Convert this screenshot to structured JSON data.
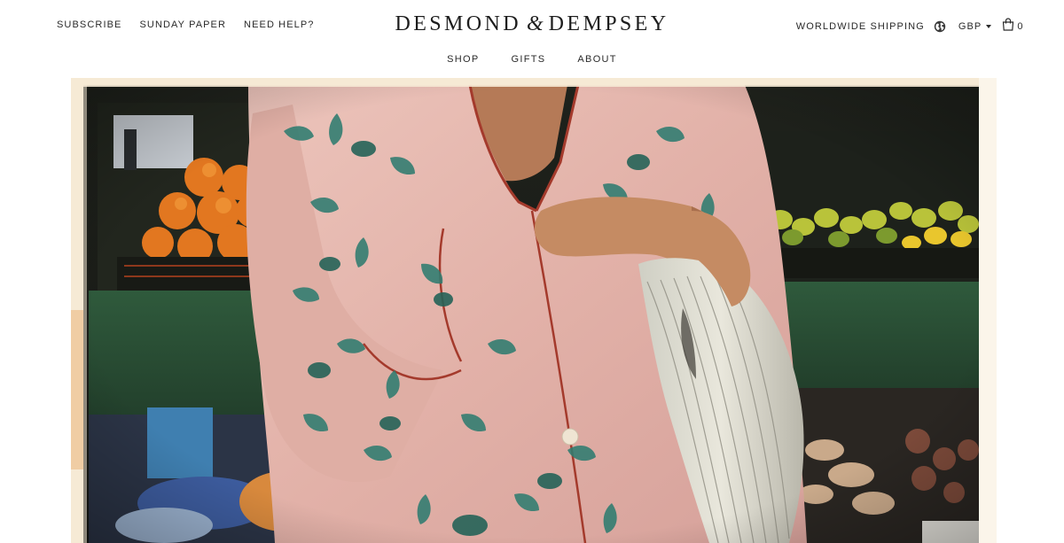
{
  "header": {
    "left_links": [
      {
        "label": "SUBSCRIBE"
      },
      {
        "label": "SUNDAY PAPER"
      },
      {
        "label": "NEED HELP?"
      }
    ],
    "brand": {
      "part1": "DESMOND",
      "amp": "&",
      "part2": "DEMPSEY"
    },
    "right": {
      "shipping_label": "WORLDWIDE SHIPPING",
      "globe_icon": "globe-icon",
      "currency": "GBP",
      "cart_icon": "shopping-bag-icon",
      "cart_count": "0"
    },
    "nav": [
      {
        "label": "SHOP"
      },
      {
        "label": "GIFTS"
      },
      {
        "label": "ABOUT"
      }
    ]
  },
  "hero": {
    "image_icon": "hero-photo"
  },
  "colors": {
    "text": "#2a2a2a",
    "pajama_pink": "#e3b6ae",
    "pattern_teal": "#2f7c70",
    "piping_red": "#a43a2c",
    "stall_green": "#2d4a35",
    "orange_fruit": "#e57a22"
  }
}
